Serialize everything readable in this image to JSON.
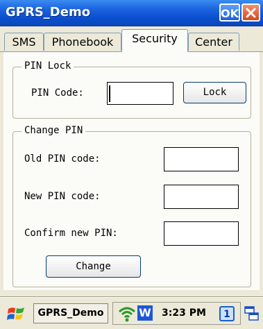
{
  "window": {
    "title": "GPRS_Demo",
    "ok_label": "OK"
  },
  "tabs": [
    {
      "label": "SMS",
      "active": false
    },
    {
      "label": "Phonebook",
      "active": false
    },
    {
      "label": "Security",
      "active": true
    },
    {
      "label": "Center",
      "active": false
    }
  ],
  "pin_lock": {
    "legend": "PIN Lock",
    "pin_code_label": "PIN Code:",
    "pin_code_value": "",
    "lock_button": "Lock"
  },
  "change_pin": {
    "legend": "Change PIN",
    "old_label": "Old PIN code:",
    "old_value": "",
    "new_label": "New PIN code:",
    "new_value": "",
    "confirm_label": "Confirm new PIN:",
    "confirm_value": "",
    "change_button": "Change"
  },
  "taskbar": {
    "start_icon": "windows-flag-icon",
    "task_button": "GPRS_Demo",
    "clock": "3:23 PM",
    "desktop_number": "1",
    "tray_icons": [
      "wireless-signal-icon",
      "w-app-icon",
      "window-switch-icon"
    ]
  },
  "colors": {
    "titlebar": "#0a4fd0",
    "panel": "#fbfbf7",
    "chrome": "#ece9d8"
  }
}
